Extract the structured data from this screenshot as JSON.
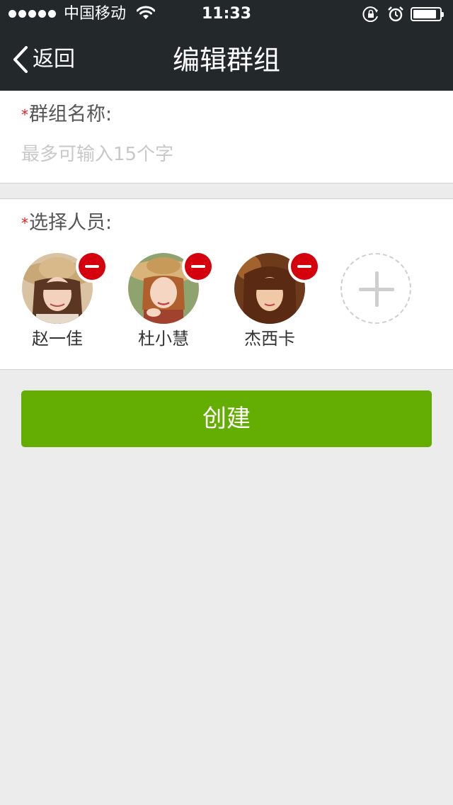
{
  "status_bar": {
    "carrier": "中国移动",
    "time": "11:33",
    "battery_level": 0.9
  },
  "nav": {
    "back_label": "返回",
    "title": "编辑群组"
  },
  "group_name": {
    "label": "群组名称:",
    "required_mark": "*",
    "value": "",
    "placeholder": "最多可输入15个字"
  },
  "members": {
    "label": "选择人员:",
    "required_mark": "*",
    "items": [
      {
        "name": "赵一佳"
      },
      {
        "name": "杜小慧"
      },
      {
        "name": "杰西卡"
      }
    ]
  },
  "create_button": {
    "label": "创建"
  },
  "colors": {
    "nav_background": "#23292b",
    "primary_green": "#64ae04",
    "remove_red": "#d5000d",
    "required_red": "#e02020",
    "page_background": "#ececec"
  }
}
